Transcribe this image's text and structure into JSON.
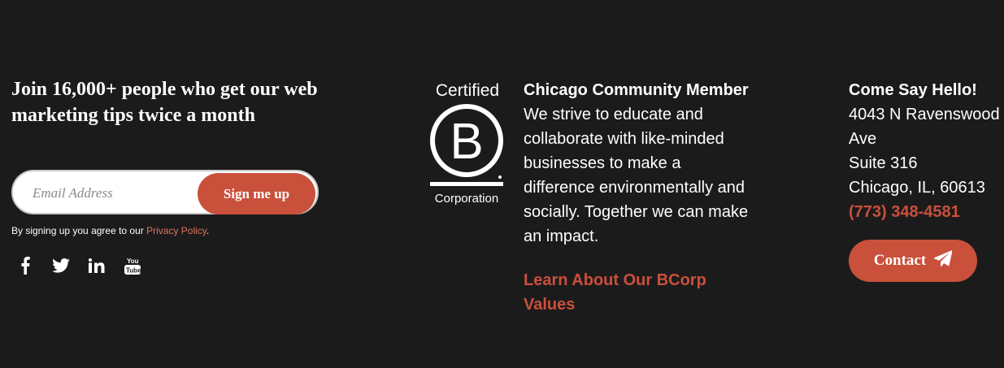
{
  "newsletter": {
    "headline": "Join 16,000+ people who get our web marketing tips twice a month",
    "email_placeholder": "Email Address",
    "signup_label": "Sign me up",
    "agree_text": "By signing up you agree to our ",
    "privacy_link": "Privacy Policy",
    "agree_suffix": "."
  },
  "social": [
    "facebook-icon",
    "twitter-icon",
    "linkedin-icon",
    "youtube-icon"
  ],
  "bcorp": {
    "logo_top": "Certified",
    "logo_letter": "B",
    "logo_bottom": "Corporation",
    "title": "Chicago Community Member",
    "body": "We strive to educate and collaborate with like-minded businesses to make a difference environmentally and socially. Together we can make an impact.",
    "link": "Learn About Our BCorp Values"
  },
  "contact": {
    "title": "Come Say Hello!",
    "address_1": "4043 N Ravenswood Ave",
    "address_2": "Suite 316",
    "address_3": "Chicago, IL, 60613",
    "phone": "(773) 348-4581",
    "button_label": "Contact"
  },
  "colors": {
    "background": "#1c1b1c",
    "accent": "#c9503b"
  }
}
